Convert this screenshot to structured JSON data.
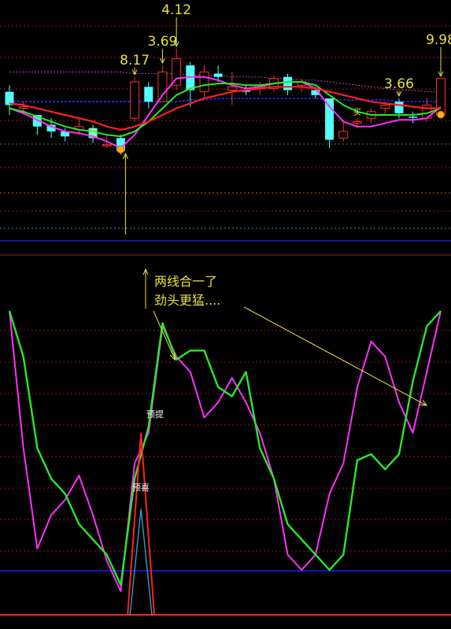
{
  "colors": {
    "background": "#000000",
    "up_candle": "#ff3030",
    "down_candle": "#54ffff",
    "ma_red": "#ff2020",
    "ma_green": "#28e828",
    "ma_magenta": "#ff30ff",
    "ma_blue": "#2030ff",
    "ma_purple_dotted": "#c040c0",
    "annotation": "#e8e040",
    "osc_green": "#28e828",
    "osc_magenta": "#ff30ff",
    "osc_red": "#ff2020",
    "osc_cyan": "#30a0c0",
    "baseline_blue": "#1818ff",
    "grid_red": "#a01818"
  },
  "chart_data": [
    {
      "type": "candlestick",
      "panel": "price",
      "ylim": [
        0,
        100
      ],
      "x": [
        1,
        2,
        3,
        4,
        5,
        6,
        7,
        8,
        9,
        10,
        11,
        12,
        13,
        14,
        15,
        16,
        17,
        18,
        19,
        20,
        21,
        22,
        23,
        24,
        25,
        26,
        27,
        28,
        29,
        30,
        31,
        32
      ],
      "candles": [
        {
          "o": 46,
          "c": 54,
          "h": 58,
          "l": 40,
          "dir": "down"
        },
        {
          "o": 44,
          "c": 45,
          "h": 48,
          "l": 40,
          "dir": "up"
        },
        {
          "o": 40,
          "c": 33,
          "h": 40,
          "l": 28,
          "dir": "down"
        },
        {
          "o": 34,
          "c": 30,
          "h": 38,
          "l": 26,
          "dir": "down"
        },
        {
          "o": 30,
          "c": 27,
          "h": 32,
          "l": 24,
          "dir": "down"
        },
        {
          "o": 33,
          "c": 31,
          "h": 38,
          "l": 28,
          "dir": "up"
        },
        {
          "o": 32,
          "c": 26,
          "h": 34,
          "l": 23,
          "dir": "down"
        },
        {
          "o": 22,
          "c": 22,
          "h": 28,
          "l": 20,
          "dir": "up"
        },
        {
          "o": 26,
          "c": 18,
          "h": 28,
          "l": 16,
          "dir": "down"
        },
        {
          "o": 38,
          "c": 60,
          "h": 63,
          "l": 36,
          "dir": "up"
        },
        {
          "o": 57,
          "c": 48,
          "h": 60,
          "l": 44,
          "dir": "down"
        },
        {
          "o": 48,
          "c": 66,
          "h": 70,
          "l": 48,
          "dir": "up"
        },
        {
          "o": 58,
          "c": 74,
          "h": 80,
          "l": 55,
          "dir": "up"
        },
        {
          "o": 70,
          "c": 55,
          "h": 72,
          "l": 45,
          "dir": "down"
        },
        {
          "o": 54,
          "c": 66,
          "h": 70,
          "l": 50,
          "dir": "up"
        },
        {
          "o": 65,
          "c": 63,
          "h": 70,
          "l": 60,
          "dir": "down"
        },
        {
          "o": 55,
          "c": 57,
          "h": 66,
          "l": 46,
          "dir": "up"
        },
        {
          "o": 55,
          "c": 54,
          "h": 58,
          "l": 52,
          "dir": "down"
        },
        {
          "o": 58,
          "c": 56,
          "h": 60,
          "l": 52,
          "dir": "up"
        },
        {
          "o": 56,
          "c": 62,
          "h": 64,
          "l": 54,
          "dir": "up"
        },
        {
          "o": 63,
          "c": 55,
          "h": 65,
          "l": 52,
          "dir": "down"
        },
        {
          "o": 58,
          "c": 60,
          "h": 62,
          "l": 54,
          "dir": "up"
        },
        {
          "o": 55,
          "c": 52,
          "h": 57,
          "l": 50,
          "dir": "down"
        },
        {
          "o": 50,
          "c": 25,
          "h": 50,
          "l": 20,
          "dir": "down"
        },
        {
          "o": 26,
          "c": 30,
          "h": 36,
          "l": 24,
          "dir": "up"
        },
        {
          "o": 35,
          "c": 36,
          "h": 38,
          "l": 32,
          "dir": "up"
        },
        {
          "o": 38,
          "c": 42,
          "h": 44,
          "l": 35,
          "dir": "up"
        },
        {
          "o": 44,
          "c": 46,
          "h": 48,
          "l": 40,
          "dir": "up"
        },
        {
          "o": 48,
          "c": 41,
          "h": 50,
          "l": 38,
          "dir": "down"
        },
        {
          "o": 39,
          "c": 39,
          "h": 42,
          "l": 35,
          "dir": "down"
        },
        {
          "o": 38,
          "c": 46,
          "h": 50,
          "l": 36,
          "dir": "up"
        },
        {
          "o": 40,
          "c": 62,
          "h": 62,
          "l": 38,
          "dir": "up"
        }
      ],
      "series": [
        {
          "key": "red",
          "values": [
            47,
            46,
            44,
            42,
            40,
            38,
            36,
            33,
            31,
            33,
            36,
            40,
            44,
            47,
            50,
            52,
            54,
            55,
            56,
            57,
            57,
            57,
            56,
            54,
            52,
            50,
            48,
            47,
            46,
            45,
            44,
            44
          ]
        },
        {
          "key": "green",
          "values": [
            44,
            42,
            39,
            36,
            33,
            31,
            30,
            28,
            27,
            30,
            36,
            44,
            52,
            56,
            58,
            59,
            59,
            58,
            58,
            59,
            60,
            60,
            58,
            52,
            46,
            42,
            40,
            40,
            40,
            40,
            41,
            44
          ]
        },
        {
          "key": "magenta",
          "values": [
            44,
            41,
            37,
            33,
            30,
            29,
            27,
            24,
            20,
            28,
            40,
            52,
            62,
            63,
            63,
            61,
            58,
            56,
            57,
            59,
            60,
            60,
            56,
            45,
            36,
            33,
            33,
            35,
            37,
            37,
            38,
            45
          ]
        },
        {
          "key": "blue_dotted",
          "values": [
            48,
            48,
            48,
            48,
            48,
            48,
            48,
            48,
            48,
            48,
            48,
            48,
            48,
            49,
            49,
            50,
            50,
            50,
            50,
            50,
            50,
            50,
            50,
            49,
            49,
            49,
            49,
            49,
            48,
            48,
            48,
            48
          ]
        },
        {
          "key": "purple_dotted",
          "values": [
            66,
            66,
            66,
            66,
            66,
            66,
            66,
            66,
            66,
            65,
            65,
            65,
            65,
            64,
            64,
            64,
            63,
            63,
            63,
            62,
            62,
            61,
            61,
            60,
            59,
            58,
            57,
            56,
            55,
            55,
            54,
            54
          ]
        }
      ],
      "annotations": [
        {
          "text": "8.17",
          "x": 10
        },
        {
          "text": "3.69",
          "x": 12
        },
        {
          "text": "4.12",
          "x": 13
        },
        {
          "text": "3.66",
          "x": 29
        },
        {
          "text": "9.98",
          "x": 32
        }
      ],
      "markers": [
        {
          "text": "买",
          "x": 7
        },
        {
          "text": "买",
          "x": 26
        }
      ]
    },
    {
      "type": "line",
      "panel": "oscillator",
      "ylim": [
        0,
        100
      ],
      "x": [
        1,
        2,
        3,
        4,
        5,
        6,
        7,
        8,
        9,
        10,
        11,
        12,
        13,
        14,
        15,
        16,
        17,
        18,
        19,
        20,
        21,
        22,
        23,
        24,
        25,
        26,
        27,
        28,
        29,
        30,
        31,
        32
      ],
      "series": [
        {
          "key": "green",
          "values": [
            100,
            85,
            55,
            45,
            40,
            30,
            25,
            20,
            10,
            45,
            62,
            96,
            84,
            87,
            87,
            75,
            72,
            80,
            55,
            45,
            30,
            25,
            20,
            15,
            20,
            51,
            53,
            48,
            53,
            77,
            95,
            100
          ]
        },
        {
          "key": "magenta",
          "values": [
            100,
            55,
            22,
            33,
            38,
            46,
            33,
            18,
            8,
            50,
            60,
            95,
            85,
            80,
            65,
            70,
            78,
            70,
            60,
            45,
            20,
            15,
            20,
            40,
            50,
            75,
            90,
            85,
            70,
            60,
            80,
            100
          ]
        },
        {
          "key": "red",
          "values": [
            0,
            0,
            0,
            0,
            0,
            0,
            0,
            0,
            0,
            60,
            0,
            0,
            0,
            0,
            0,
            0,
            0,
            0,
            0,
            0,
            0,
            0,
            0,
            0,
            0,
            0,
            0,
            0,
            0,
            0,
            0,
            0
          ]
        },
        {
          "key": "cyan",
          "values": [
            0,
            0,
            0,
            0,
            0,
            0,
            0,
            0,
            0,
            35,
            0,
            0,
            0,
            0,
            0,
            0,
            0,
            0,
            0,
            0,
            0,
            0,
            0,
            0,
            0,
            0,
            0,
            0,
            0,
            0,
            0,
            0
          ]
        }
      ],
      "annotations": [
        {
          "key": "line1",
          "text": "两线合一了"
        },
        {
          "key": "line2",
          "text": "劲头更猛...."
        },
        {
          "key": "yuti",
          "text": "预提"
        },
        {
          "key": "yuxi",
          "text": "预喜"
        }
      ]
    }
  ]
}
